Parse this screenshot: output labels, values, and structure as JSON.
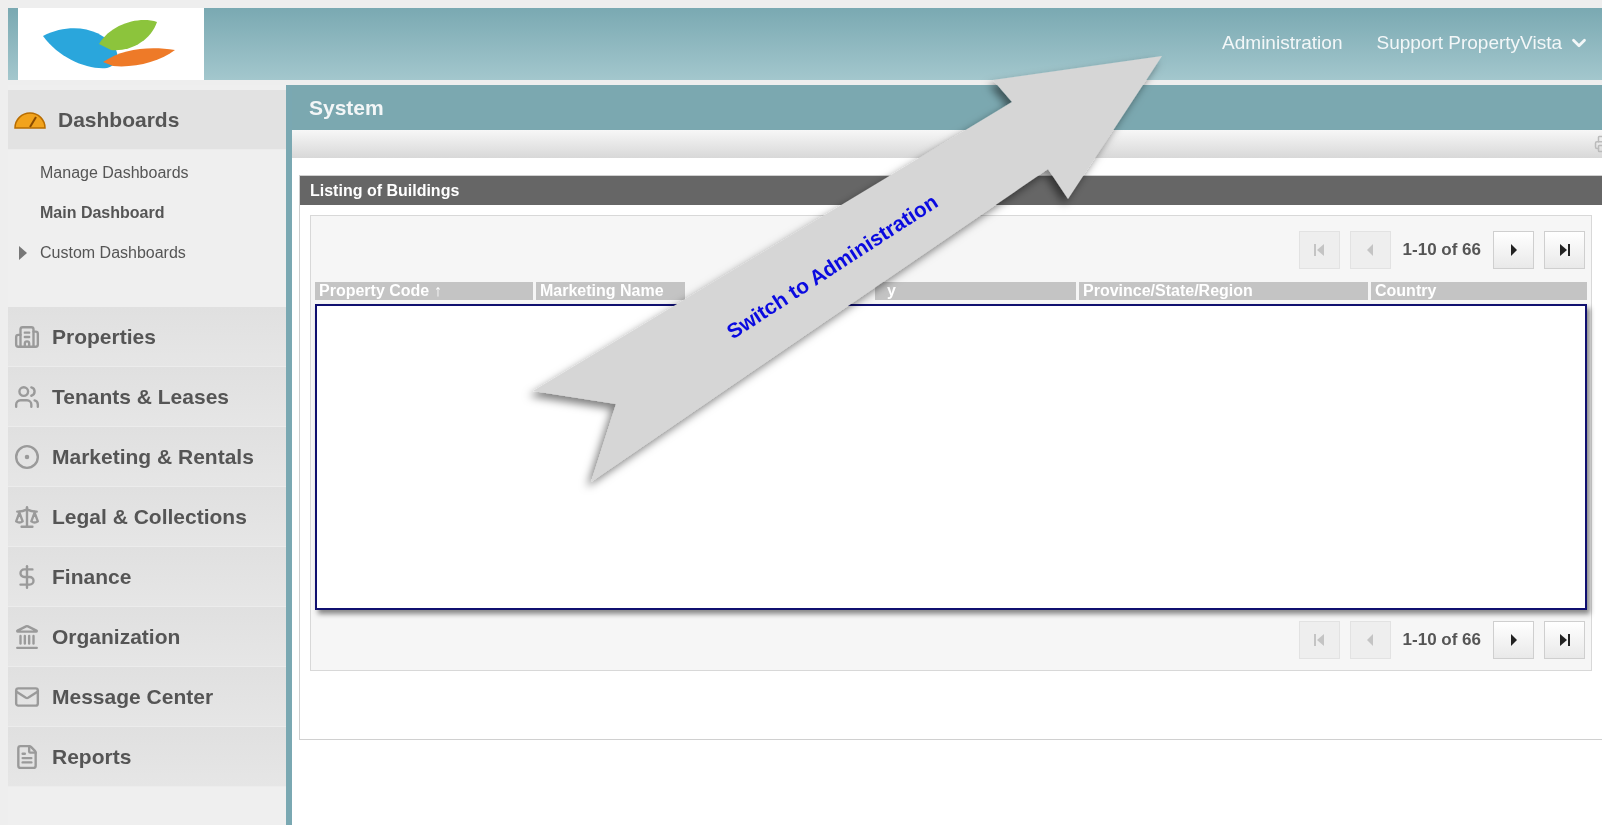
{
  "header": {
    "links": [
      {
        "label": "Administration",
        "dropdown": false
      },
      {
        "label": "Support PropertyVista",
        "dropdown": true
      }
    ]
  },
  "sidebar": {
    "items": [
      {
        "label": "Dashboards",
        "expanded": true,
        "children": [
          {
            "label": "Manage Dashboards",
            "selected": false
          },
          {
            "label": "Main Dashboard",
            "selected": true
          },
          {
            "label": "Custom Dashboards",
            "selected": false,
            "expanded": false
          }
        ]
      },
      {
        "label": "Properties"
      },
      {
        "label": "Tenants & Leases"
      },
      {
        "label": "Marketing & Rentals"
      },
      {
        "label": "Legal & Collections"
      },
      {
        "label": "Finance"
      },
      {
        "label": "Organization"
      },
      {
        "label": "Message Center"
      },
      {
        "label": "Reports"
      }
    ]
  },
  "page": {
    "title": "System"
  },
  "panel": {
    "title": "Listing of Buildings",
    "pager_top": {
      "range": "1-10 of 66",
      "buttons": [
        {
          "kind": "first",
          "disabled": true
        },
        {
          "kind": "prev",
          "disabled": true
        },
        {
          "kind": "next",
          "disabled": false
        },
        {
          "kind": "last",
          "disabled": false
        }
      ]
    },
    "table": {
      "columns": [
        {
          "label": "Property Code ↑"
        },
        {
          "label": "Marketing Name"
        },
        {
          "label": "y"
        },
        {
          "label": "Province/State/Region"
        },
        {
          "label": "Country"
        }
      ]
    },
    "pager_bottom": {
      "range": "1-10 of 66",
      "buttons": [
        {
          "kind": "first",
          "disabled": true
        },
        {
          "kind": "prev",
          "disabled": true
        },
        {
          "kind": "next",
          "disabled": false
        },
        {
          "kind": "last",
          "disabled": false
        }
      ]
    }
  },
  "callout": {
    "text": "Switch to Administration"
  }
}
